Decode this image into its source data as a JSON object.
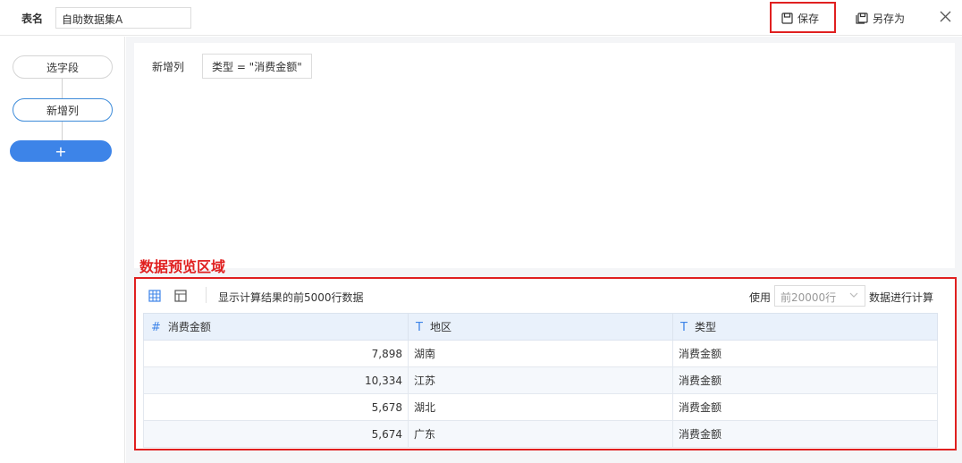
{
  "header": {
    "table_name_label": "表名",
    "table_name_value": "自助数据集A",
    "save_label": "保存",
    "save_as_label": "另存为",
    "close_icon": "close-icon"
  },
  "steps": {
    "items": [
      {
        "label": "选字段"
      },
      {
        "label": "新增列"
      }
    ],
    "add_label": "+"
  },
  "config": {
    "label": "新增列",
    "expression": "类型 = \"消费金额\""
  },
  "annotation": "数据预览区域",
  "preview": {
    "info": "显示计算结果的前5000行数据",
    "use_label": "使用",
    "select_value": "前20000行",
    "calc_label": "数据进行计算",
    "columns": [
      {
        "type_icon": "#",
        "name": "消费金额"
      },
      {
        "type_icon": "T",
        "name": "地区"
      },
      {
        "type_icon": "T",
        "name": "类型"
      }
    ],
    "rows": [
      [
        "7,898",
        "湖南",
        "消费金额"
      ],
      [
        "10,334",
        "江苏",
        "消费金额"
      ],
      [
        "5,678",
        "湖北",
        "消费金额"
      ],
      [
        "5,674",
        "广东",
        "消费金额"
      ]
    ]
  }
}
